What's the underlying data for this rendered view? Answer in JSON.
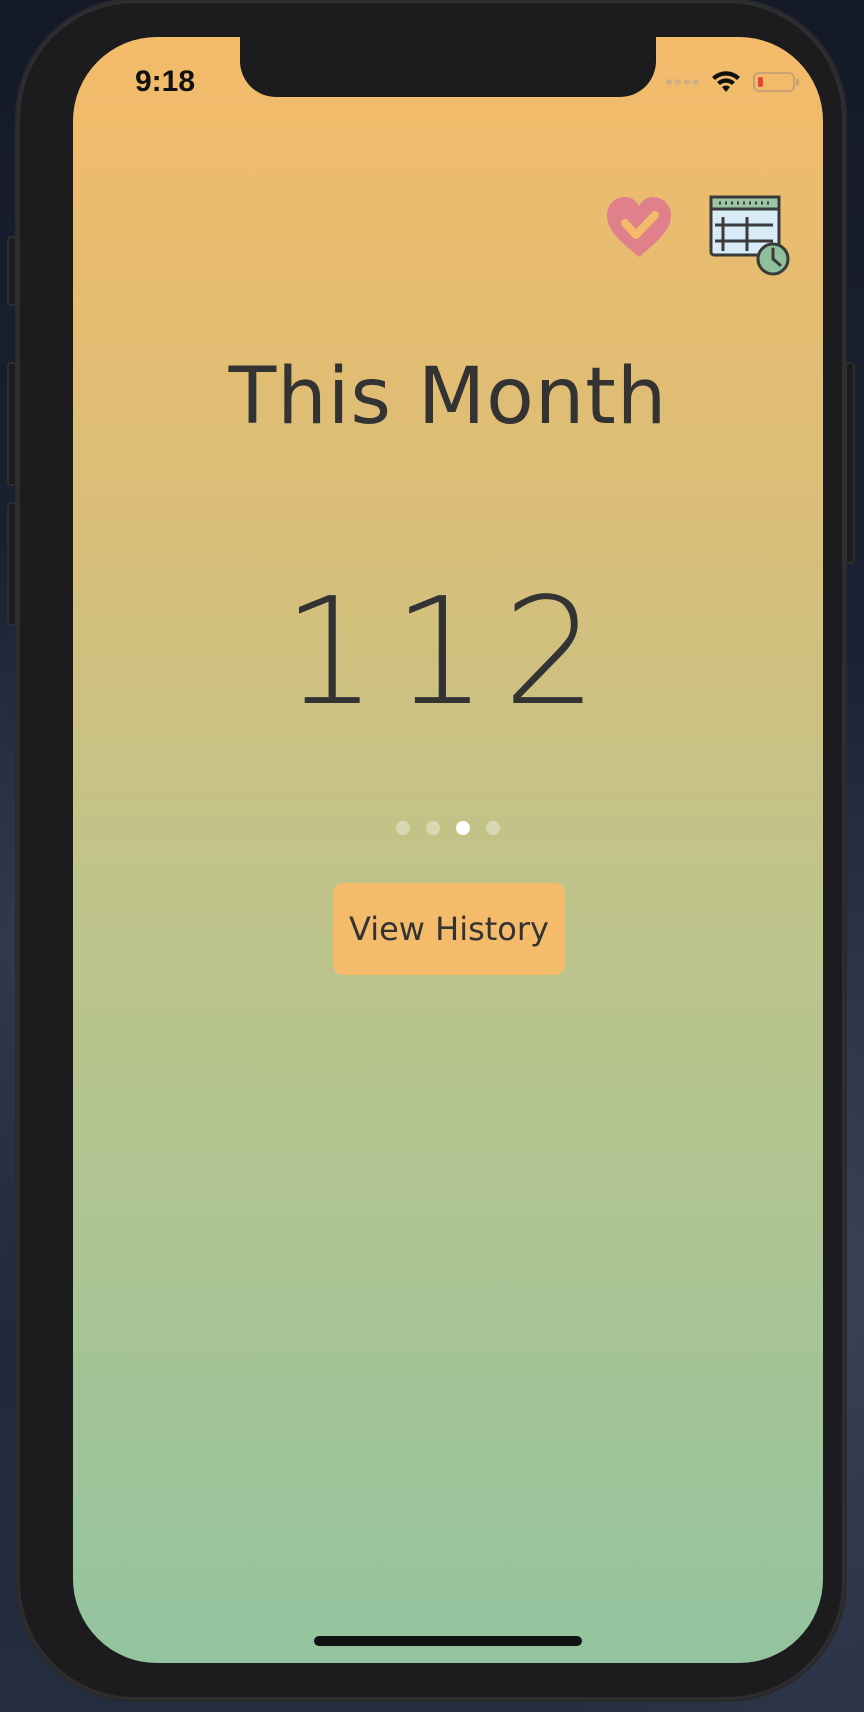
{
  "status_bar": {
    "time": "9:18",
    "icons": [
      "cellular-signal-icon",
      "wifi-icon",
      "battery-low-icon"
    ]
  },
  "toolbar": {
    "icons": [
      "heart-check-icon",
      "calendar-clock-icon"
    ]
  },
  "main": {
    "title": "This Month",
    "count": "112",
    "pager": {
      "total": 4,
      "active_index": 2
    },
    "history_button_label": "View History"
  },
  "colors": {
    "gradient_top": "#f4bb6a",
    "gradient_bottom": "#93c49f",
    "button_bg": "#f4bb6a",
    "text": "#333333",
    "heart": "#e0808a"
  }
}
